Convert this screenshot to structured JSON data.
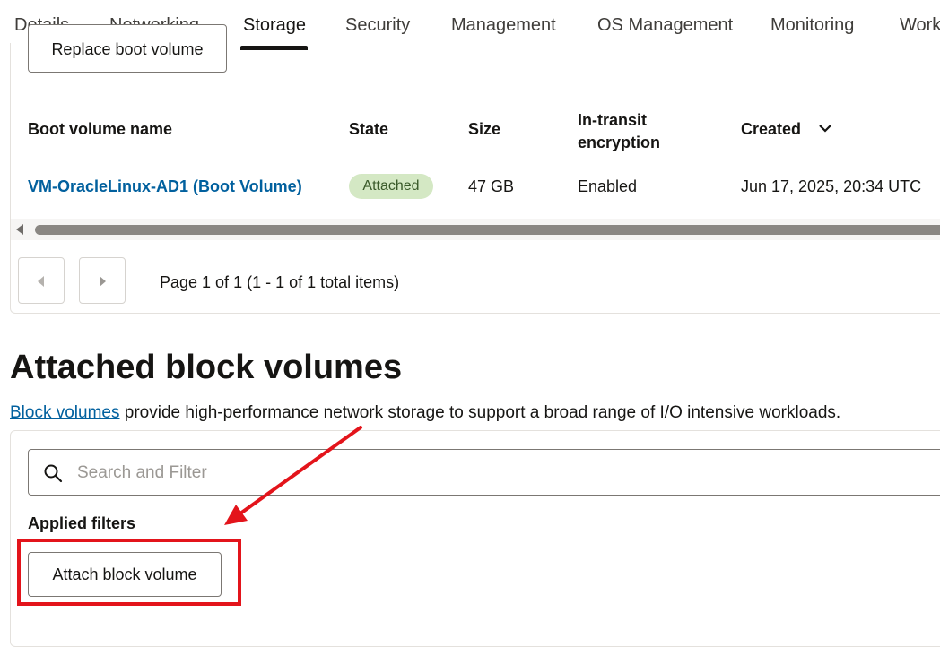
{
  "tabs": [
    {
      "label": "Details",
      "active": false
    },
    {
      "label": "Networking",
      "active": false
    },
    {
      "label": "Storage",
      "active": true
    },
    {
      "label": "Security",
      "active": false
    },
    {
      "label": "Management",
      "active": false
    },
    {
      "label": "OS Management",
      "active": false
    },
    {
      "label": "Monitoring",
      "active": false
    },
    {
      "label": "Work",
      "active": false
    }
  ],
  "boot_volume": {
    "replace_button_label": "Replace boot volume",
    "columns": [
      "Boot volume name",
      "State",
      "Size",
      "In-transit encryption",
      "Created"
    ],
    "rows": [
      {
        "name": "VM-OracleLinux-AD1 (Boot Volume)",
        "state": "Attached",
        "size": "47 GB",
        "encryption": "Enabled",
        "created": "Jun 17, 2025, 20:34 UTC"
      }
    ],
    "pagination_text": "Page 1 of 1 (1 - 1 of 1 total items)"
  },
  "block_volumes": {
    "title": "Attached block volumes",
    "description_link": "Block volumes",
    "description_rest": " provide high-performance network storage to support a broad range of I/O intensive workloads.",
    "search_placeholder": "Search and Filter",
    "applied_filters_label": "Applied filters",
    "attach_button_label": "Attach block volume"
  },
  "colors": {
    "link": "#01609e",
    "badge_bg": "#d4e8c4",
    "annotation": "#e3141b"
  },
  "icons": {
    "sort": "chevron-down-icon",
    "search": "search-icon",
    "prev": "chevron-left-icon",
    "next": "chevron-right-icon"
  }
}
